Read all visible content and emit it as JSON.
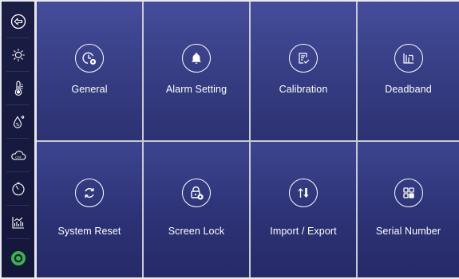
{
  "sidebar": {
    "items": [
      {
        "icon": "back-arrow-icon"
      },
      {
        "icon": "light-icon"
      },
      {
        "icon": "thermometer-icon"
      },
      {
        "icon": "humidity-icon"
      },
      {
        "icon": "co2-cloud-icon"
      },
      {
        "icon": "timer-icon"
      },
      {
        "icon": "chart-icon"
      },
      {
        "icon": "settings-active-icon"
      }
    ],
    "cloud_label": "CO2",
    "active_color": "#3db34a"
  },
  "tiles": [
    {
      "label": "General",
      "icon": "clock-gear-icon"
    },
    {
      "label": "Alarm Setting",
      "icon": "bell-icon"
    },
    {
      "label": "Calibration",
      "icon": "calibration-icon"
    },
    {
      "label": "Deadband",
      "icon": "deadband-icon"
    },
    {
      "label": "System Reset",
      "icon": "reset-icon"
    },
    {
      "label": "Screen Lock",
      "icon": "lock-gear-icon"
    },
    {
      "label": "Import / Export",
      "icon": "import-export-icon"
    },
    {
      "label": "Serial Number",
      "icon": "serial-grid-icon"
    }
  ]
}
